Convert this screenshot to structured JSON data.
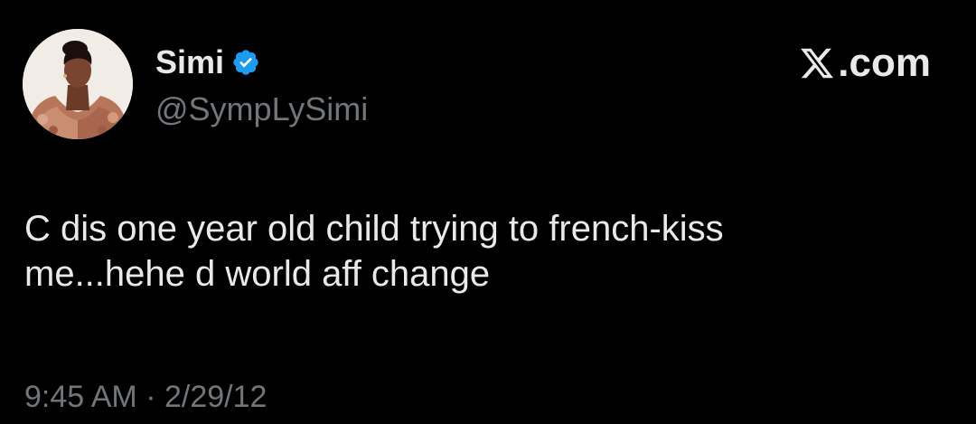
{
  "author": {
    "display_name": "Simi",
    "handle": "@SympLySimi",
    "verified": true,
    "verified_color": "#1d9bf0"
  },
  "site": {
    "label": ".com",
    "logo_icon": "x-logo-icon"
  },
  "tweet": {
    "text": "C dis one year old child trying to french-kiss\nme...hehe d world aff change",
    "time": "9:45 AM",
    "separator": " · ",
    "date": "2/29/12"
  },
  "colors": {
    "background": "#000000",
    "primary_text": "#e7e9ea",
    "secondary_text": "#71767b"
  }
}
